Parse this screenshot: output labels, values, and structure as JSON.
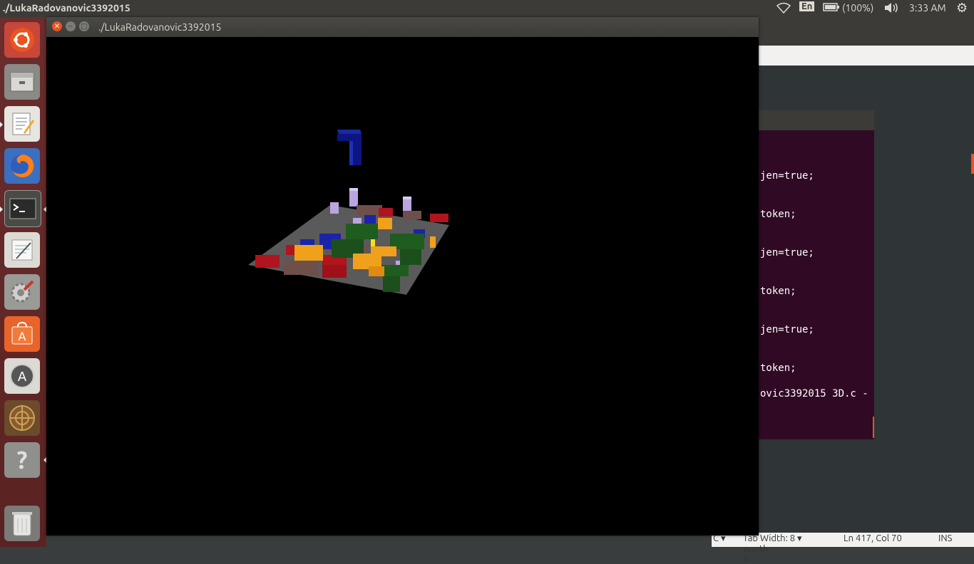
{
  "topbar": {
    "app_title": "./LukaRadovanovic3392015",
    "keyboard_layout": "En",
    "battery": "(100%)",
    "clock": "3:33 AM"
  },
  "launcher": {
    "items": [
      "Ubuntu Dash",
      "Files",
      "Text Editor",
      "Firefox",
      "Terminal",
      "Notes",
      "System Settings",
      "Ubuntu Software",
      "Software Updater",
      "Game",
      "Help",
      "Trash"
    ]
  },
  "window": {
    "title": "./LukaRadovanovic3392015"
  },
  "editor": {
    "terminal_lines": [
      "jen=true;",
      "token;",
      "jen=true;",
      "token;",
      "jen=true;",
      "token;",
      "ovic3392015 3D.c -"
    ],
    "status": {
      "language": "C",
      "tab_width": "Tab Width: 8",
      "position": "Ln 417, Col 70",
      "mode": "INS"
    }
  },
  "colors": {
    "panel": "#3c3b37",
    "launcher": "#5f2727",
    "terminal_bg": "#300a24",
    "accent": "#e95420"
  }
}
